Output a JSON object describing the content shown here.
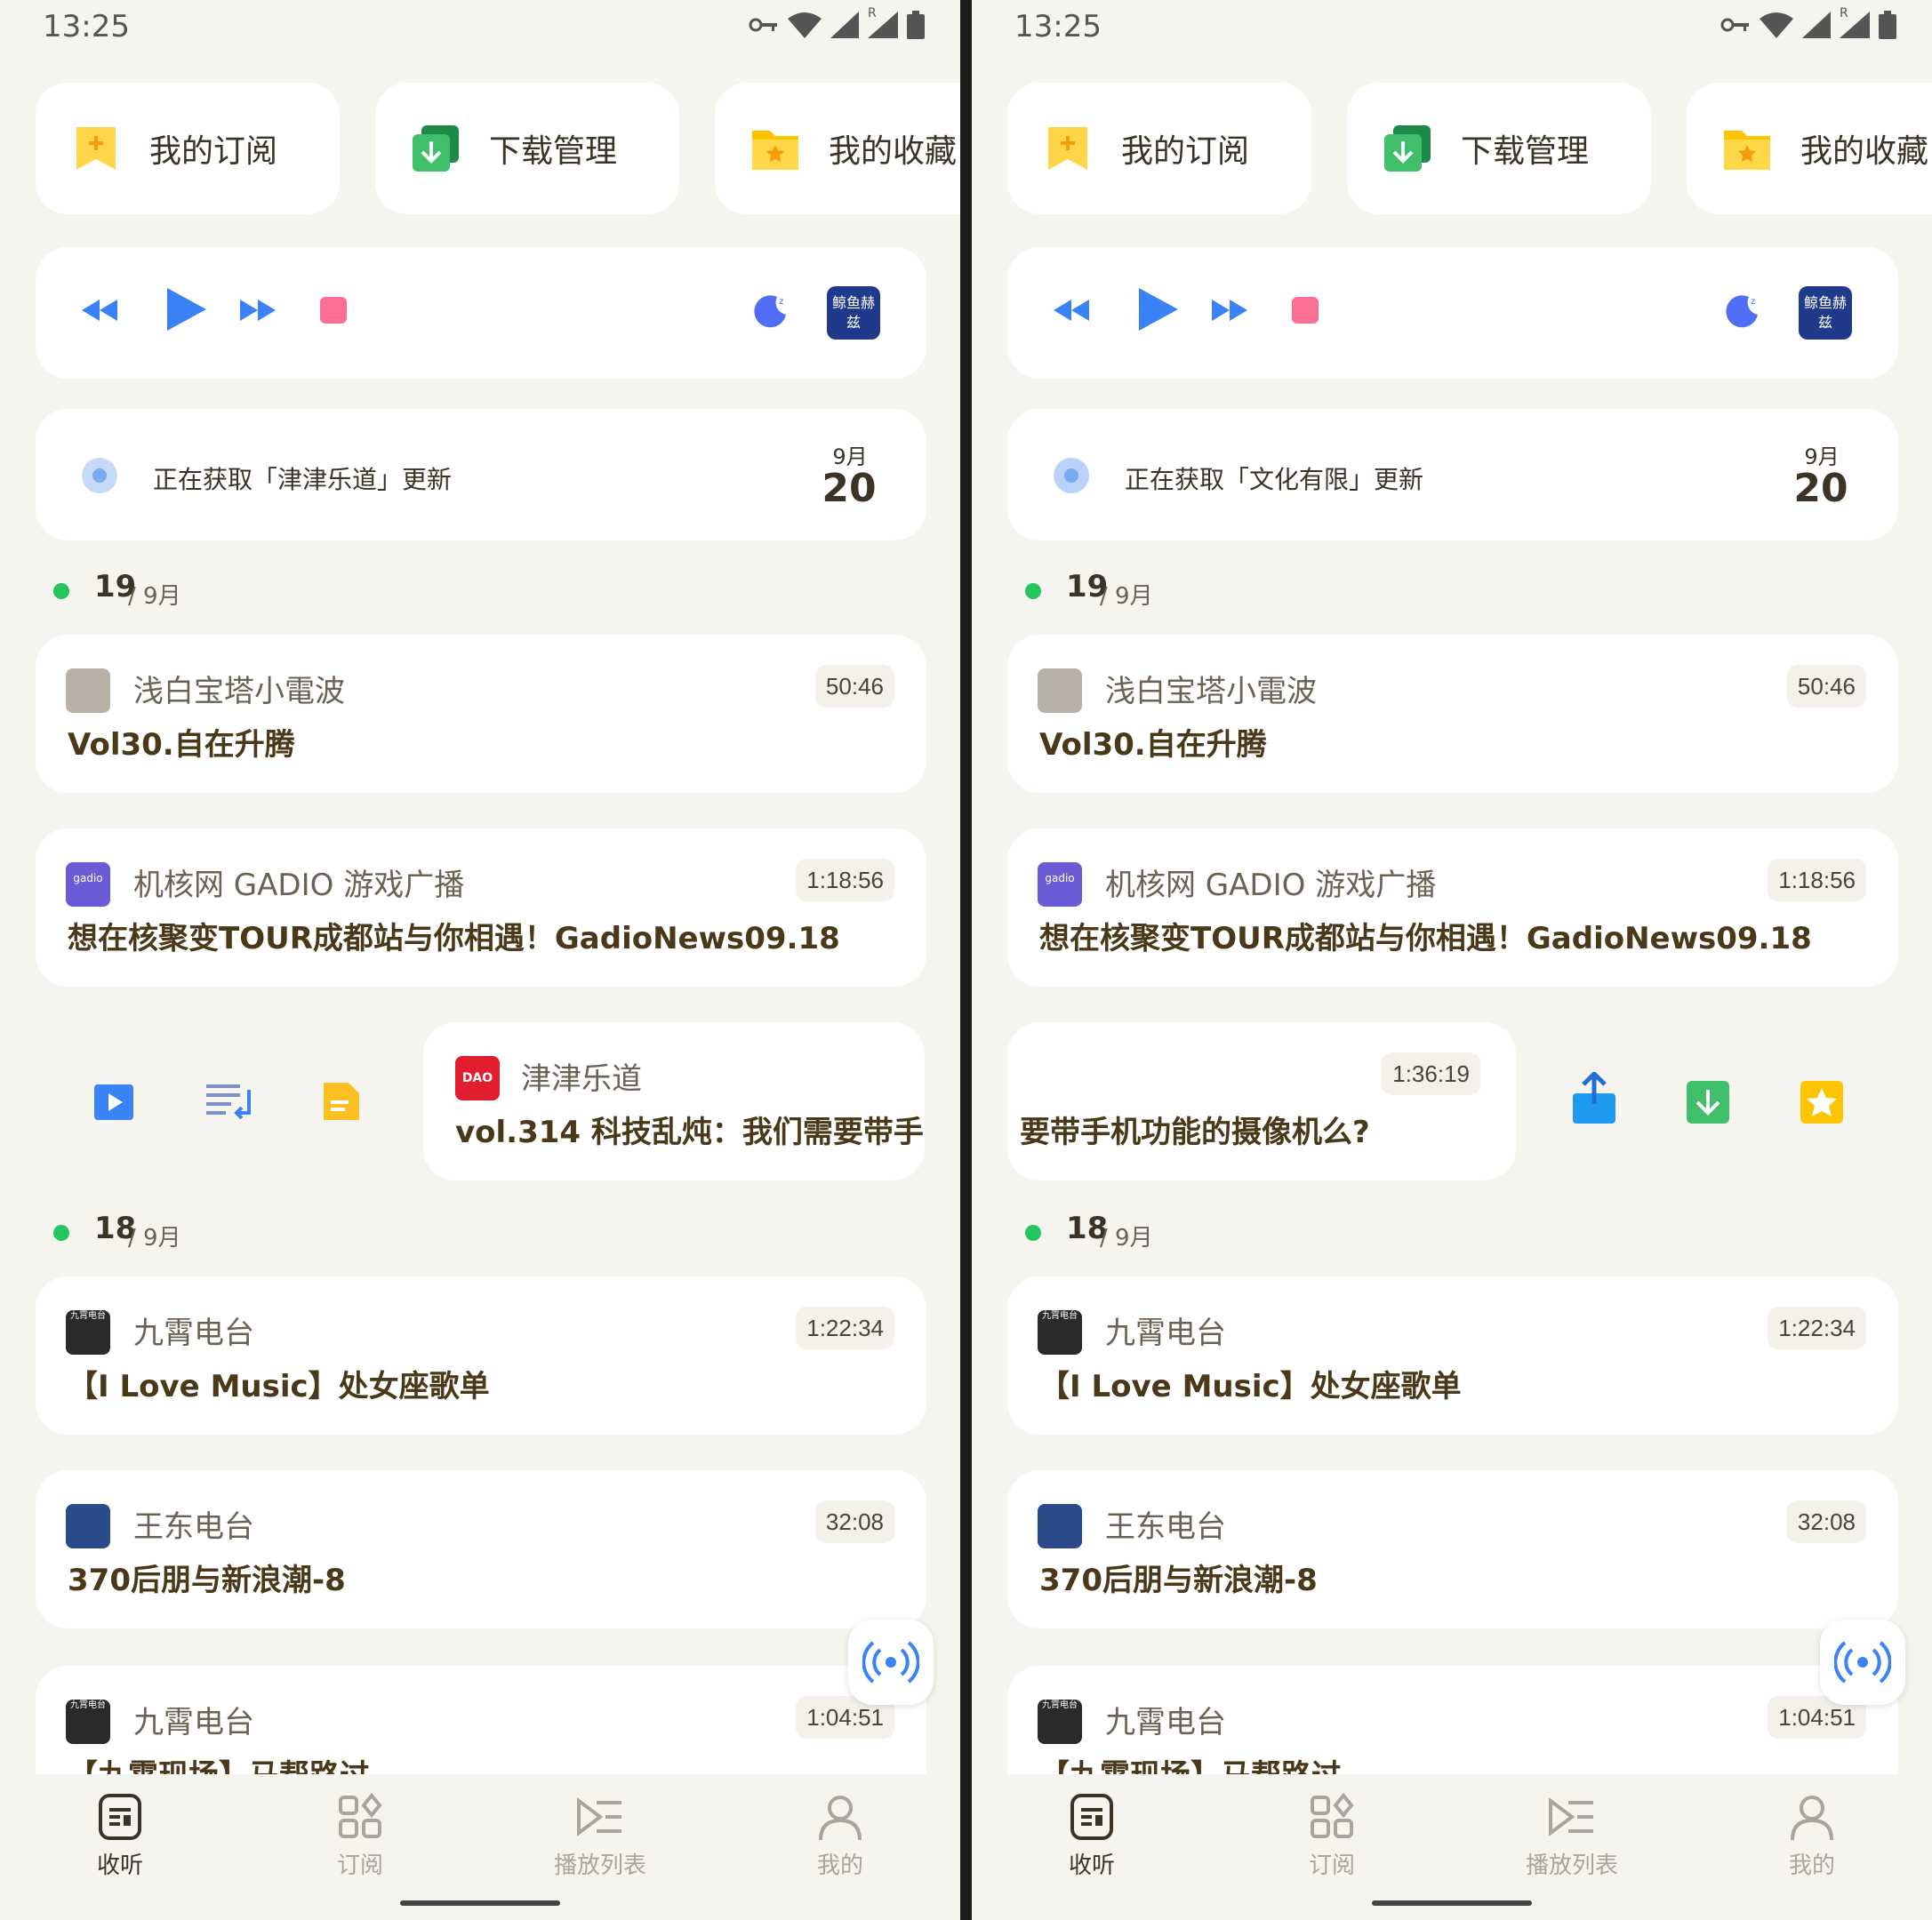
{
  "status_bar": {
    "time": "13:25",
    "roaming_label": "R"
  },
  "quick_cards": [
    {
      "label": "我的订阅",
      "icon": "subscription-icon"
    },
    {
      "label": "下载管理",
      "icon": "download-manager-icon"
    },
    {
      "label": "我的收藏",
      "icon": "favorites-folder-icon"
    }
  ],
  "player": {
    "podcast_cover_text": "鲸鱼赫兹",
    "icons": [
      "rewind-icon",
      "play-icon",
      "fast-forward-icon",
      "stop-icon",
      "sleep-timer-icon"
    ]
  },
  "left": {
    "fetch": {
      "text": "正在获取「津津乐道」更新",
      "month": "9月",
      "day": "20"
    },
    "swiped_card": {
      "podcast": "津津乐道",
      "title": "vol.314 科技乱炖：我们需要带手",
      "avatar_text": "DAO"
    }
  },
  "right": {
    "fetch": {
      "text": "正在获取「文化有限」更新",
      "month": "9月",
      "day": "20"
    },
    "swiped_card": {
      "duration": "1:36:19",
      "title": "要带手机功能的摄像机么?"
    }
  },
  "date_groups": [
    {
      "day": "19",
      "month": "/ 9月"
    },
    {
      "day": "18",
      "month": "/ 9月"
    }
  ],
  "episodes": [
    {
      "podcast": "浅白宝塔小電波",
      "title": "Vol30.自在升腾",
      "duration": "50:46",
      "avatar_color": "#b8b2a6"
    },
    {
      "podcast": "机核网 GADIO 游戏广播",
      "title": "想在核聚变TOUR成都站与你相遇！GadioNews09.18",
      "duration": "1:18:56",
      "avatar_color": "#6b5bd6",
      "avatar_text": "gadio"
    },
    {
      "podcast": "九霄电台",
      "title": "【I Love Music】处女座歌单",
      "duration": "1:22:34",
      "avatar_color": "#2a2a2a",
      "avatar_text": "九霄电台"
    },
    {
      "podcast": "王东电台",
      "title": "370后朋与新浪潮-8",
      "duration": "32:08",
      "avatar_color": "#2a4a8a"
    },
    {
      "podcast": "九霄电台",
      "title": "【九霄现场】马帮路过",
      "duration": "1:04:51",
      "avatar_color": "#2a2a2a",
      "avatar_text": "九霄电台"
    }
  ],
  "swipe_actions_left": [
    "video-icon",
    "add-to-playlist-icon",
    "notes-icon"
  ],
  "swipe_actions_right": [
    "share-icon",
    "download-icon",
    "favorite-star-icon"
  ],
  "bottom_nav": [
    {
      "label": "收听",
      "icon": "listen-icon",
      "active": true
    },
    {
      "label": "订阅",
      "icon": "subscriptions-grid-icon",
      "active": false
    },
    {
      "label": "播放列表",
      "icon": "playlist-icon",
      "active": false
    },
    {
      "label": "我的",
      "icon": "profile-icon",
      "active": false
    }
  ],
  "colors": {
    "background": "#f6f4ee",
    "card": "#ffffff",
    "accent_blue": "#3b82f6",
    "green_dot": "#22c55e",
    "title_brown": "#4a3818"
  }
}
